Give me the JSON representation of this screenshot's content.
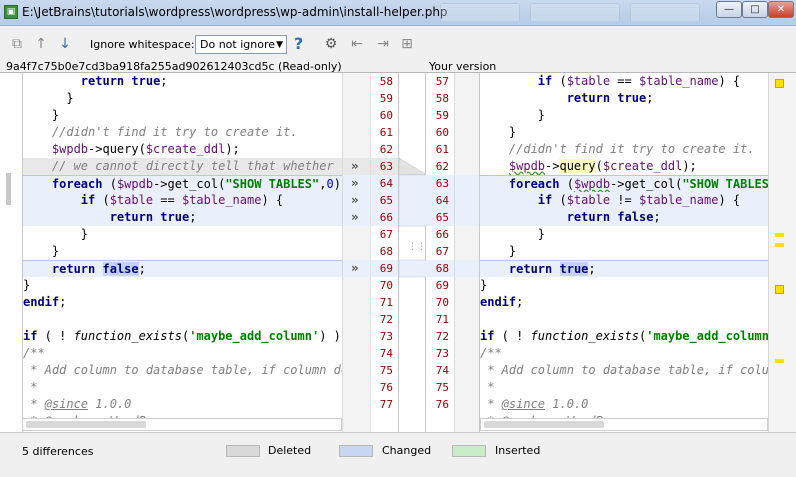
{
  "window": {
    "title": "E:\\JetBrains\\tutorials\\wordpress\\wordpress\\wp-admin\\install-helper.php",
    "minimize_label": "—",
    "maximize_label": "□",
    "close_label": "✕"
  },
  "toolbar": {
    "ignore_whitespace_label": "Ignore whitespace:",
    "ignore_whitespace_value": "Do not ignore",
    "help_label": "?"
  },
  "left_pane": {
    "caption": "9a4f7c75b0e7cd3ba918fa255ad902612403cd5c (Read-only)",
    "line_numbers": [
      "58",
      "59",
      "60",
      "61",
      "62",
      "63",
      "64",
      "65",
      "66",
      "67",
      "68",
      "69",
      "70",
      "71",
      "72",
      "73",
      "74",
      "75",
      "76",
      "77"
    ]
  },
  "right_pane": {
    "caption": "Your version",
    "line_numbers": [
      "57",
      "58",
      "59",
      "60",
      "61",
      "62",
      "63",
      "64",
      "65",
      "66",
      "67",
      "68",
      "69",
      "70",
      "71",
      "72",
      "73",
      "74",
      "75",
      "76"
    ]
  },
  "status": {
    "differences": "5 differences",
    "legend": [
      {
        "label": "Deleted",
        "color": "#d9d9d9"
      },
      {
        "label": "Changed",
        "color": "#c9d6f1"
      },
      {
        "label": "Inserted",
        "color": "#c9ecc9"
      }
    ]
  },
  "colors": {
    "changed_background": "#eaf0fb",
    "deleted_background": "#e8e8e8",
    "line_number_color": "#9a0000",
    "stripe_marker": "#ffe000"
  }
}
